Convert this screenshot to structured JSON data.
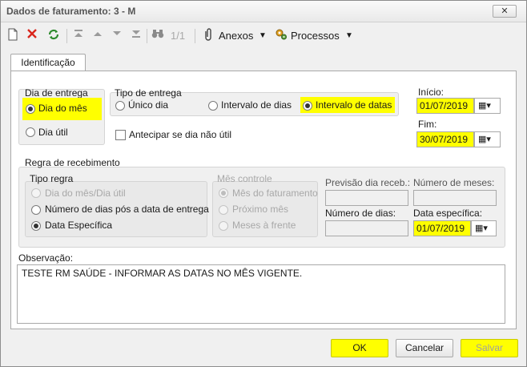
{
  "window": {
    "title": "Dados de faturamento: 3 - M",
    "close_glyph": "✕"
  },
  "toolbar": {
    "page_indicator": "1/1",
    "anexos_label": "Anexos",
    "processos_label": "Processos",
    "icons": [
      "new-icon",
      "delete-icon",
      "refresh-icon",
      "first-icon",
      "prev-icon",
      "next-icon",
      "last-icon",
      "binoculars-icon",
      "paperclip-icon",
      "process-icon"
    ]
  },
  "tabs": [
    {
      "label": "Identificação"
    }
  ],
  "dia_entrega": {
    "title": "Dia de entrega",
    "options": [
      {
        "label": "Dia do mês",
        "selected": true
      },
      {
        "label": "Dia útil",
        "selected": false
      }
    ]
  },
  "tipo_entrega": {
    "title": "Tipo de entrega",
    "options": [
      {
        "label": "Único dia",
        "selected": false
      },
      {
        "label": "Intervalo de dias",
        "selected": false
      },
      {
        "label": "Intervalo de datas",
        "selected": true
      }
    ],
    "antecipar_label": "Antecipar se dia não útil"
  },
  "inicio": {
    "label": "Início:",
    "value": "01/07/2019"
  },
  "fim": {
    "label": "Fim:",
    "value": "30/07/2019"
  },
  "regra": {
    "title": "Regra de recebimento",
    "tipo_regra": {
      "title": "Tipo regra",
      "options": [
        {
          "label": "Dia do mês/Dia útil",
          "selected": false,
          "disabled": true
        },
        {
          "label": "Número de dias pós a data de entrega",
          "selected": false,
          "disabled": false
        },
        {
          "label": "Data Específica",
          "selected": true,
          "disabled": false
        }
      ]
    },
    "mes_controle": {
      "title": "Mês controle",
      "options": [
        {
          "label": "Mês do faturamento",
          "selected": true
        },
        {
          "label": "Próximo mês",
          "selected": false
        },
        {
          "label": "Meses à frente",
          "selected": false
        }
      ]
    },
    "previsao_label": "Previsão dia receb.:",
    "num_meses_label": "Número de meses:",
    "num_dias_label": "Número de dias:",
    "data_especifica_label": "Data específica:",
    "data_especifica_value": "01/07/2019"
  },
  "observacao": {
    "label": "Observação:",
    "value": "TESTE RM SAÚDE - INFORMAR AS DATAS NO MÊS VIGENTE."
  },
  "buttons": {
    "ok": "OK",
    "cancelar": "Cancelar",
    "salvar": "Salvar"
  },
  "colors": {
    "highlight": "#ffff00",
    "delete_red": "#d9261c",
    "refresh_green": "#2e8b2e"
  }
}
